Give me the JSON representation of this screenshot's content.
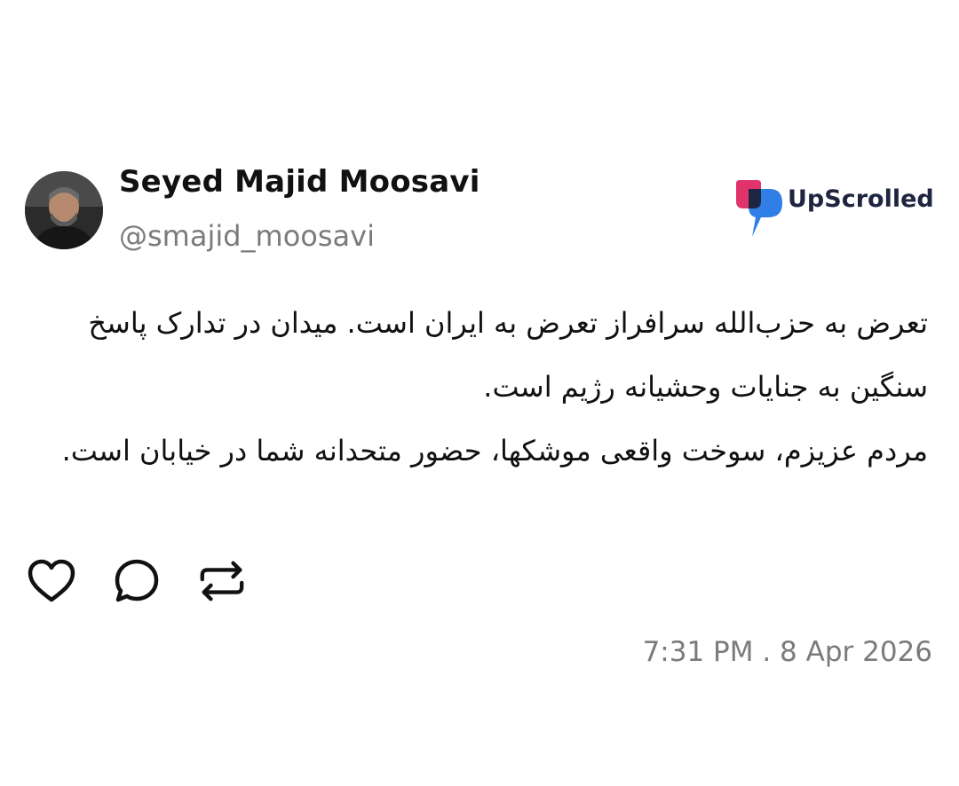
{
  "post": {
    "author": {
      "display_name": "Seyed Majid Moosavi",
      "handle": "@smajid_moosavi",
      "avatar_icon": "user-photo-avatar"
    },
    "brand": {
      "name": "UpScrolled",
      "logo_icon": "upscrolled-logo-icon",
      "colors": {
        "pink": "#e0336b",
        "blue": "#2f7fe6",
        "navy": "#1e2540"
      }
    },
    "paragraphs": [
      "تعرض به حزب‌الله سرافراز تعرض به ایران است. میدان در تدارک پاسخ سنگین به جنایات وحشیانه رژیم است.",
      "مردم عزیزم، سوخت واقعی موشکها، حضور متحدانه شما در خیابان است."
    ],
    "actions": [
      {
        "name": "like",
        "icon": "heart-icon"
      },
      {
        "name": "reply",
        "icon": "comment-icon"
      },
      {
        "name": "repost",
        "icon": "repost-icon"
      }
    ],
    "timestamp": "7:31 PM . 8 Apr 2026"
  }
}
